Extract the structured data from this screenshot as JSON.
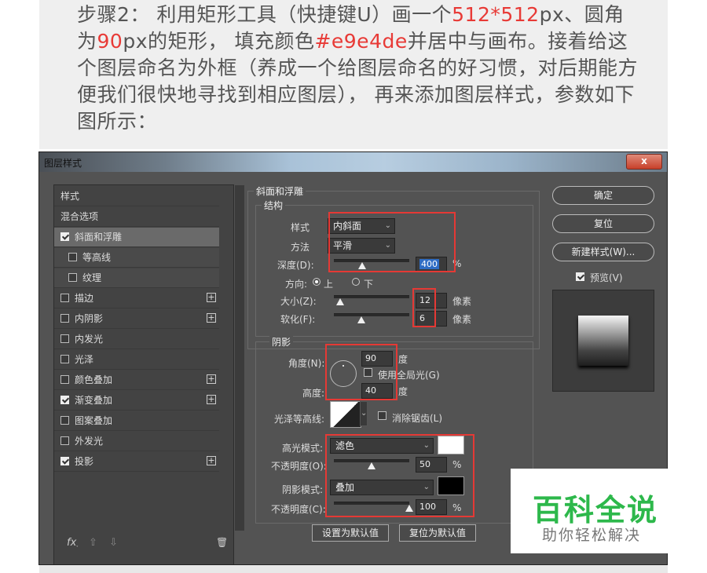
{
  "article": {
    "p1": "步骤2：  利用矩形工具（快捷键U）画一个",
    "p1_hl": "512*512",
    "p2": "px、",
    "p3": "圆角为",
    "p3_hl": "90",
    "p4": "px的矩形，  填充颜色",
    "p4_hl": "#e9e4de",
    "p5": "并居中与画布。接着给这个图层命名为外框（养成一个给图层命名的好习惯，对后期能方便我们很快地寻找到相应图层），  再来添加图层样式，参数如下图所示："
  },
  "window": {
    "title": "图层样式",
    "close": "x"
  },
  "left_list": {
    "items": [
      {
        "label": "样式"
      },
      {
        "label": "混合选项"
      },
      {
        "label": "斜面和浮雕"
      },
      {
        "label": "等高线"
      },
      {
        "label": "纹理"
      },
      {
        "label": "描边",
        "plus": "+"
      },
      {
        "label": "内阴影",
        "plus": "+"
      },
      {
        "label": "内发光"
      },
      {
        "label": "光泽"
      },
      {
        "label": "颜色叠加",
        "plus": "+"
      },
      {
        "label": "渐变叠加",
        "plus": "+"
      },
      {
        "label": "图案叠加"
      },
      {
        "label": "外发光"
      },
      {
        "label": "投影",
        "plus": "+"
      }
    ],
    "fx": "fx",
    "fx_dot": "˯",
    "up": "⇧",
    "down": "⇩",
    "trash": "🗑"
  },
  "bevel": {
    "title": "斜面和浮雕",
    "structure_title": "结构",
    "style_label": "样式",
    "style_value": "内斜面",
    "method_label": "方法",
    "method_value": "平滑",
    "depth_label": "深度(D):",
    "depth_value": "400",
    "depth_unit": "%",
    "direction_label": "方向:",
    "dir_up": "上",
    "dir_down": "下",
    "size_label": "大小(Z):",
    "size_value": "12",
    "size_unit": "像素",
    "soften_label": "软化(F):",
    "soften_value": "6",
    "soften_unit": "像素"
  },
  "shading": {
    "title": "阴影",
    "angle_label": "角度(N):",
    "angle_value": "90",
    "angle_unit": "度",
    "global_light": "使用全局光(G)",
    "altitude_label": "高度:",
    "altitude_value": "40",
    "altitude_unit": "度",
    "gloss_label": "光泽等高线:",
    "anti_alias": "消除锯齿(L)",
    "highlight_mode_label": "高光模式:",
    "highlight_mode": "滤色",
    "highlight_color": "#ffffff",
    "hl_opacity_label": "不透明度(O):",
    "hl_opacity": "50",
    "hl_opacity_unit": "%",
    "shadow_mode_label": "阴影模式:",
    "shadow_mode": "叠加",
    "shadow_color": "#000000",
    "sh_opacity_label": "不透明度(C):",
    "sh_opacity": "100",
    "sh_opacity_unit": "%",
    "make_default": "设置为默认值",
    "reset_default": "复位为默认值"
  },
  "right": {
    "ok": "确定",
    "reset": "复位",
    "new_style": "新建样式(W)...",
    "preview": "预览(V)"
  },
  "watermark": {
    "big": "百科全说",
    "small": "助你轻松解决"
  }
}
